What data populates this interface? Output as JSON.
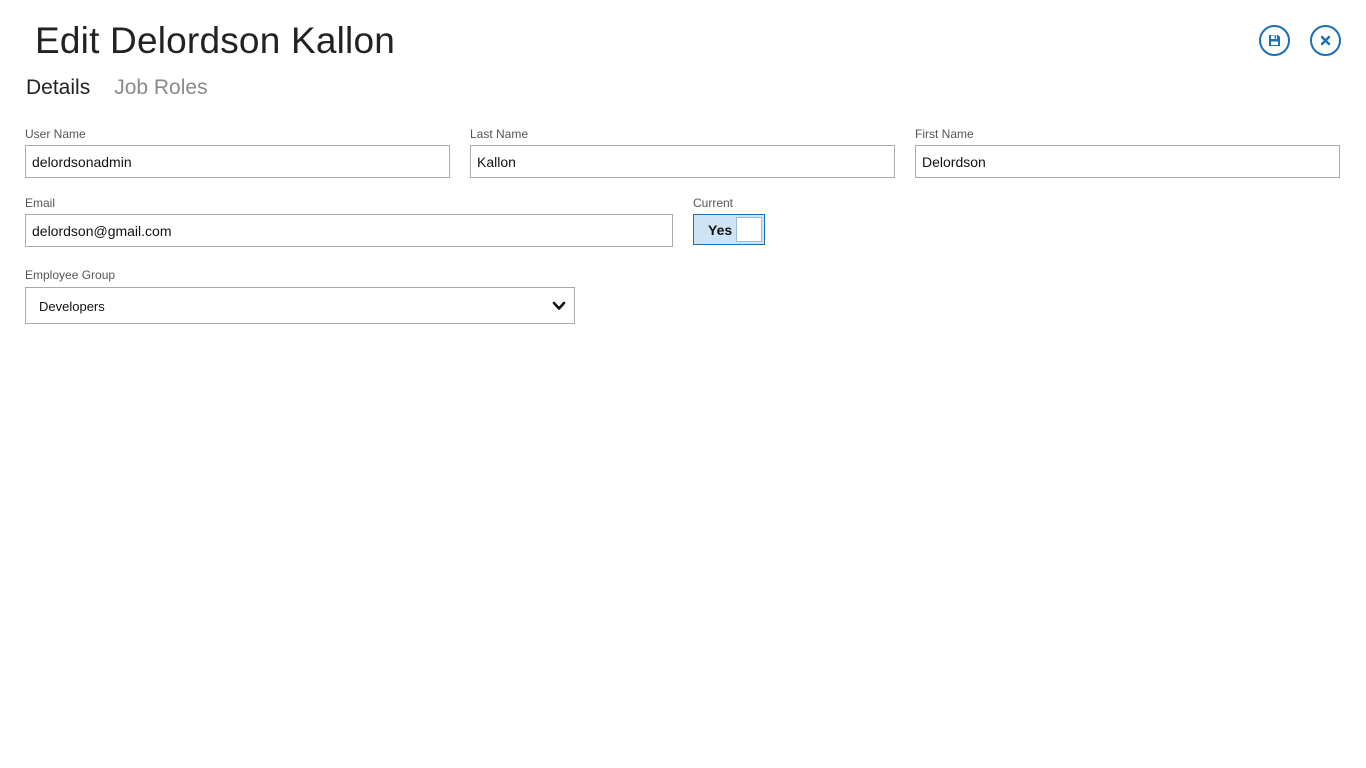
{
  "header": {
    "title": "Edit Delordson Kallon",
    "save_icon": "save-icon",
    "close_icon": "close-icon"
  },
  "tabs": [
    {
      "label": "Details",
      "active": true
    },
    {
      "label": "Job Roles",
      "active": false
    }
  ],
  "form": {
    "user_name": {
      "label": "User Name",
      "value": "delordsonadmin"
    },
    "last_name": {
      "label": "Last Name",
      "value": "Kallon"
    },
    "first_name": {
      "label": "First Name",
      "value": "Delordson"
    },
    "email": {
      "label": "Email",
      "value": "delordson@gmail.com"
    },
    "current": {
      "label": "Current",
      "value": "Yes"
    },
    "employee_group": {
      "label": "Employee Group",
      "value": "Developers"
    }
  },
  "colors": {
    "accent": "#1a6fb5",
    "toggle_on_bg": "#cfe3f7"
  }
}
